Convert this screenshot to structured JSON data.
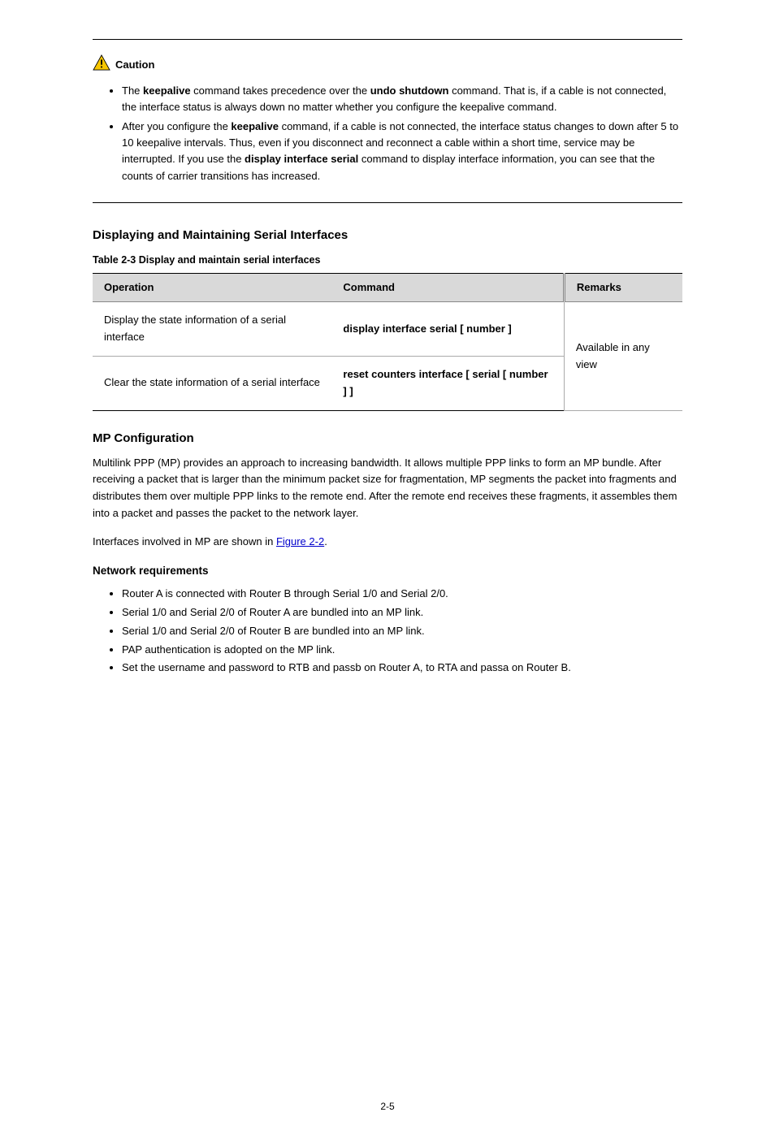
{
  "caution": {
    "label": "Caution",
    "items": [
      {
        "prefix": "The ",
        "bold1": "keepalive",
        "mid": " command takes precedence over the ",
        "bold2": "undo shutdown",
        "suffix": " command. That is, if a cable is not connected, the interface status is always down no matter whether you configure the keepalive command."
      },
      {
        "prefix": "After you configure the ",
        "bold1": "keepalive",
        "mid": " command, if a cable is not connected, the interface status changes to down after 5 to 10 keepalive intervals. Thus, even if you disconnect and reconnect a cable within a short time, service may be interrupted. If you use the ",
        "bold2": "display interface serial",
        "suffix": " command to display interface information, you can see that the counts of carrier transitions has increased."
      }
    ]
  },
  "section_display": {
    "title": "Displaying and Maintaining Serial Interfaces",
    "table_caption": "Table 2-3 Display and maintain serial interfaces",
    "headers": {
      "operation": "Operation",
      "command": "Command",
      "remarks": "Remarks"
    },
    "rows": [
      {
        "operation": "Display the state information of a serial interface",
        "command": "display interface serial [ number ]",
        "remarks_group": 0
      },
      {
        "operation": "Clear the state information of a serial interface",
        "command": "reset counters interface [ serial [ number ] ]",
        "remarks_group": 0
      }
    ],
    "remarks_group_0": "Available in any view"
  },
  "mp_section": {
    "title": "MP Configuration",
    "intro": "Multilink PPP (MP) provides an approach to increasing bandwidth. It allows multiple PPP links to form an MP bundle. After receiving a packet that is larger than the minimum packet size for fragmentation, MP segments the packet into fragments and distributes them over multiple PPP links to the remote end. After the remote end receives these fragments, it assembles them into a packet and passes the packet to the network layer.",
    "figure_sentence_prefix": "Interfaces involved in MP are shown in ",
    "figure_ref": "Figure 2-2",
    "figure_sentence_suffix": "."
  },
  "reqs_section": {
    "title": "Network requirements",
    "items": [
      "Router A is connected with Router B through Serial 1/0 and Serial 2/0.",
      "Serial 1/0 and Serial 2/0 of Router A are bundled into an MP link.",
      "Serial 1/0 and Serial 2/0 of Router B are bundled into an MP link.",
      "PAP authentication is adopted on the MP link.",
      "Set the username and password to RTB and passb on Router A, to RTA and passa on Router B."
    ]
  },
  "page_number": "2-5"
}
